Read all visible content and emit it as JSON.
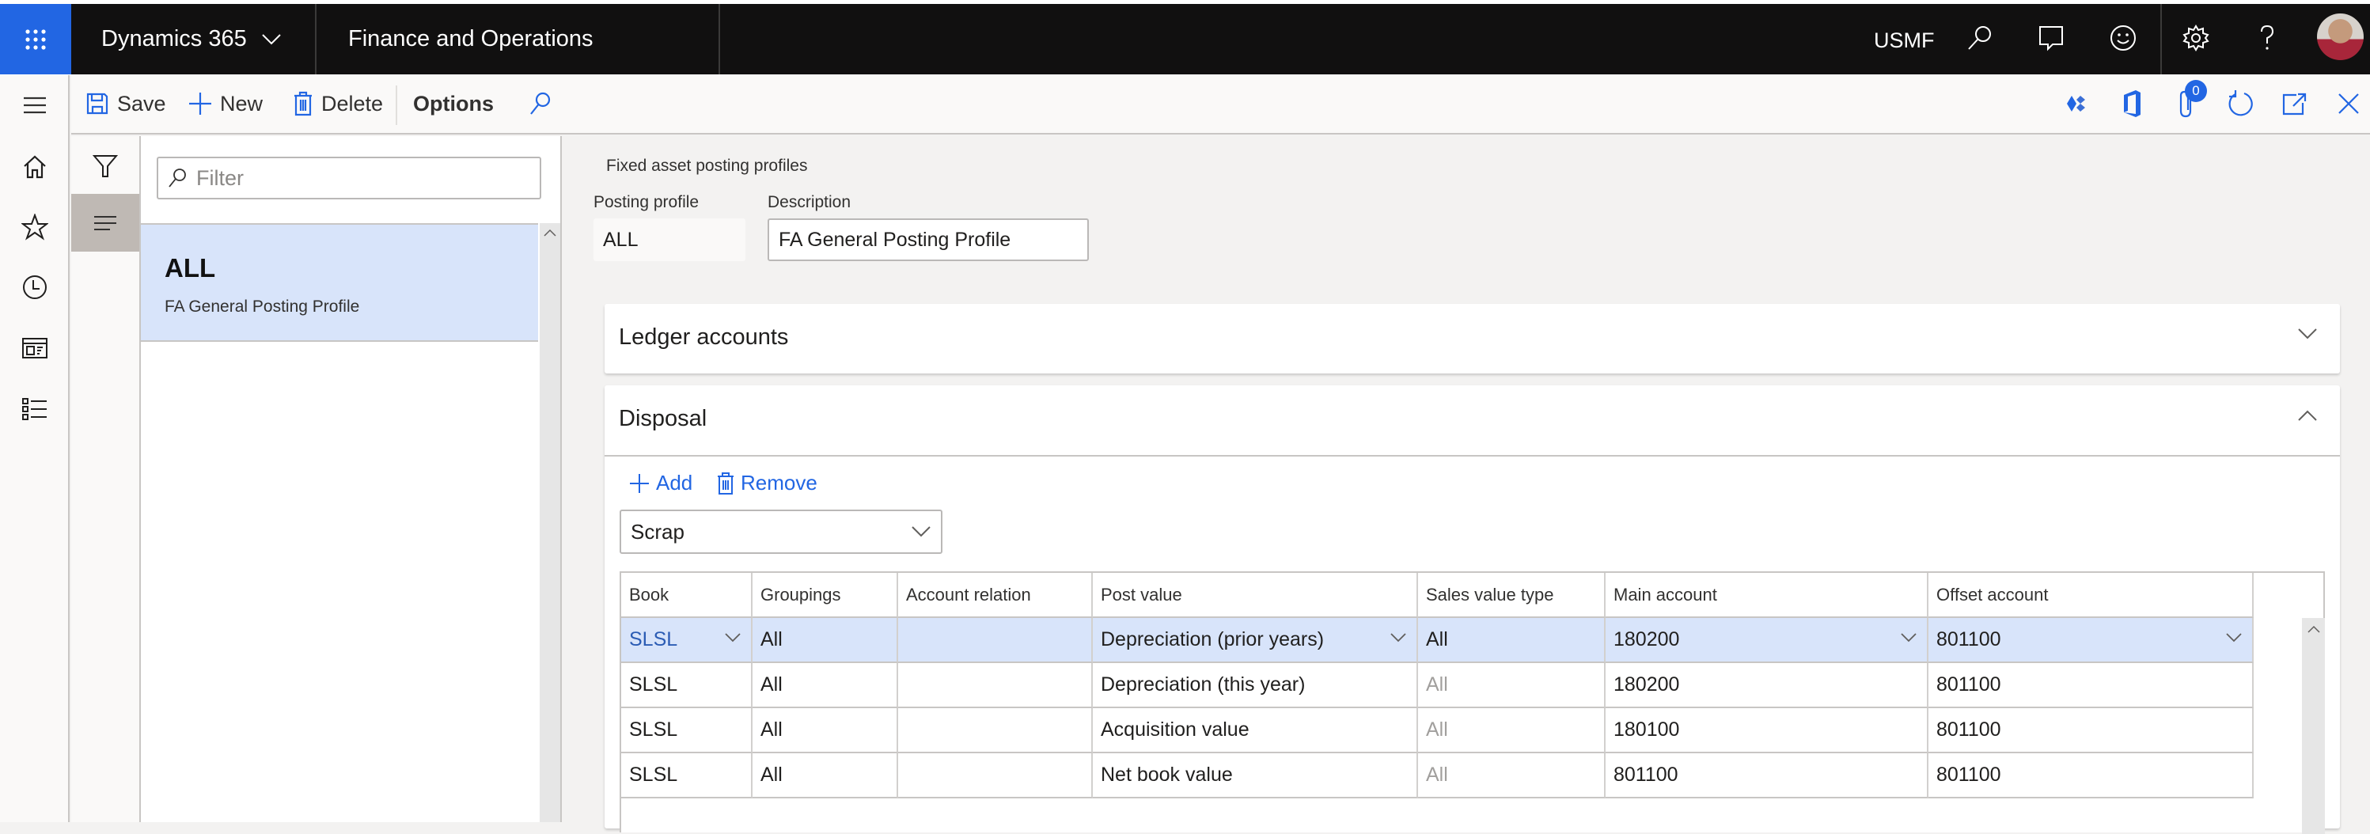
{
  "topbar": {
    "app_launcher_icon": "waffle-icon",
    "product": "Dynamics 365",
    "module": "Finance and Operations",
    "company": "USMF",
    "icons": [
      "search-icon",
      "chat-icon",
      "smiley-icon",
      "gear-icon",
      "help-icon"
    ],
    "avatar": "user-avatar"
  },
  "actionbar": {
    "save_label": "Save",
    "new_label": "New",
    "delete_label": "Delete",
    "options_label": "Options",
    "right_icons": [
      "power-apps-icon",
      "office-icon",
      "attachments-icon",
      "refresh-icon",
      "open-new-window-icon",
      "close-icon"
    ],
    "attachments_count": "0"
  },
  "navrail": {
    "items": [
      "menu-icon",
      "home-icon",
      "favorites-icon",
      "recent-icon",
      "workspaces-icon",
      "modules-icon"
    ]
  },
  "listpane": {
    "filter_placeholder": "Filter",
    "items": [
      {
        "title": "ALL",
        "subtitle": "FA General Posting Profile",
        "selected": true
      }
    ]
  },
  "main": {
    "caption": "Fixed asset posting profiles",
    "fields": {
      "posting_profile_label": "Posting profile",
      "posting_profile_value": "ALL",
      "description_label": "Description",
      "description_value": "FA General Posting Profile"
    },
    "fasttabs": {
      "ledger": {
        "title": "Ledger accounts",
        "expanded": false
      },
      "disposal": {
        "title": "Disposal",
        "expanded": true
      }
    },
    "disposal": {
      "add_label": "Add",
      "remove_label": "Remove",
      "type_select_value": "Scrap",
      "grid": {
        "columns": [
          "Book",
          "Groupings",
          "Account relation",
          "Post value",
          "Sales value type",
          "Main account",
          "Offset account"
        ],
        "rows": [
          {
            "book": "SLSL",
            "groupings": "All",
            "account_relation": "",
            "post_value": "Depreciation (prior years)",
            "sales_value_type": "All",
            "main_account": "180200",
            "offset_account": "801100",
            "selected": true
          },
          {
            "book": "SLSL",
            "groupings": "All",
            "account_relation": "",
            "post_value": "Depreciation (this year)",
            "sales_value_type": "All",
            "main_account": "180200",
            "offset_account": "801100"
          },
          {
            "book": "SLSL",
            "groupings": "All",
            "account_relation": "",
            "post_value": "Acquisition value",
            "sales_value_type": "All",
            "main_account": "180100",
            "offset_account": "801100"
          },
          {
            "book": "SLSL",
            "groupings": "All",
            "account_relation": "",
            "post_value": "Net book value",
            "sales_value_type": "All",
            "main_account": "801100",
            "offset_account": "801100"
          }
        ]
      }
    }
  },
  "colors": {
    "accent": "#2266e3",
    "topbar_bg": "#111010",
    "selection": "#d8e4fa",
    "active_tab": "#bfb9b4"
  }
}
